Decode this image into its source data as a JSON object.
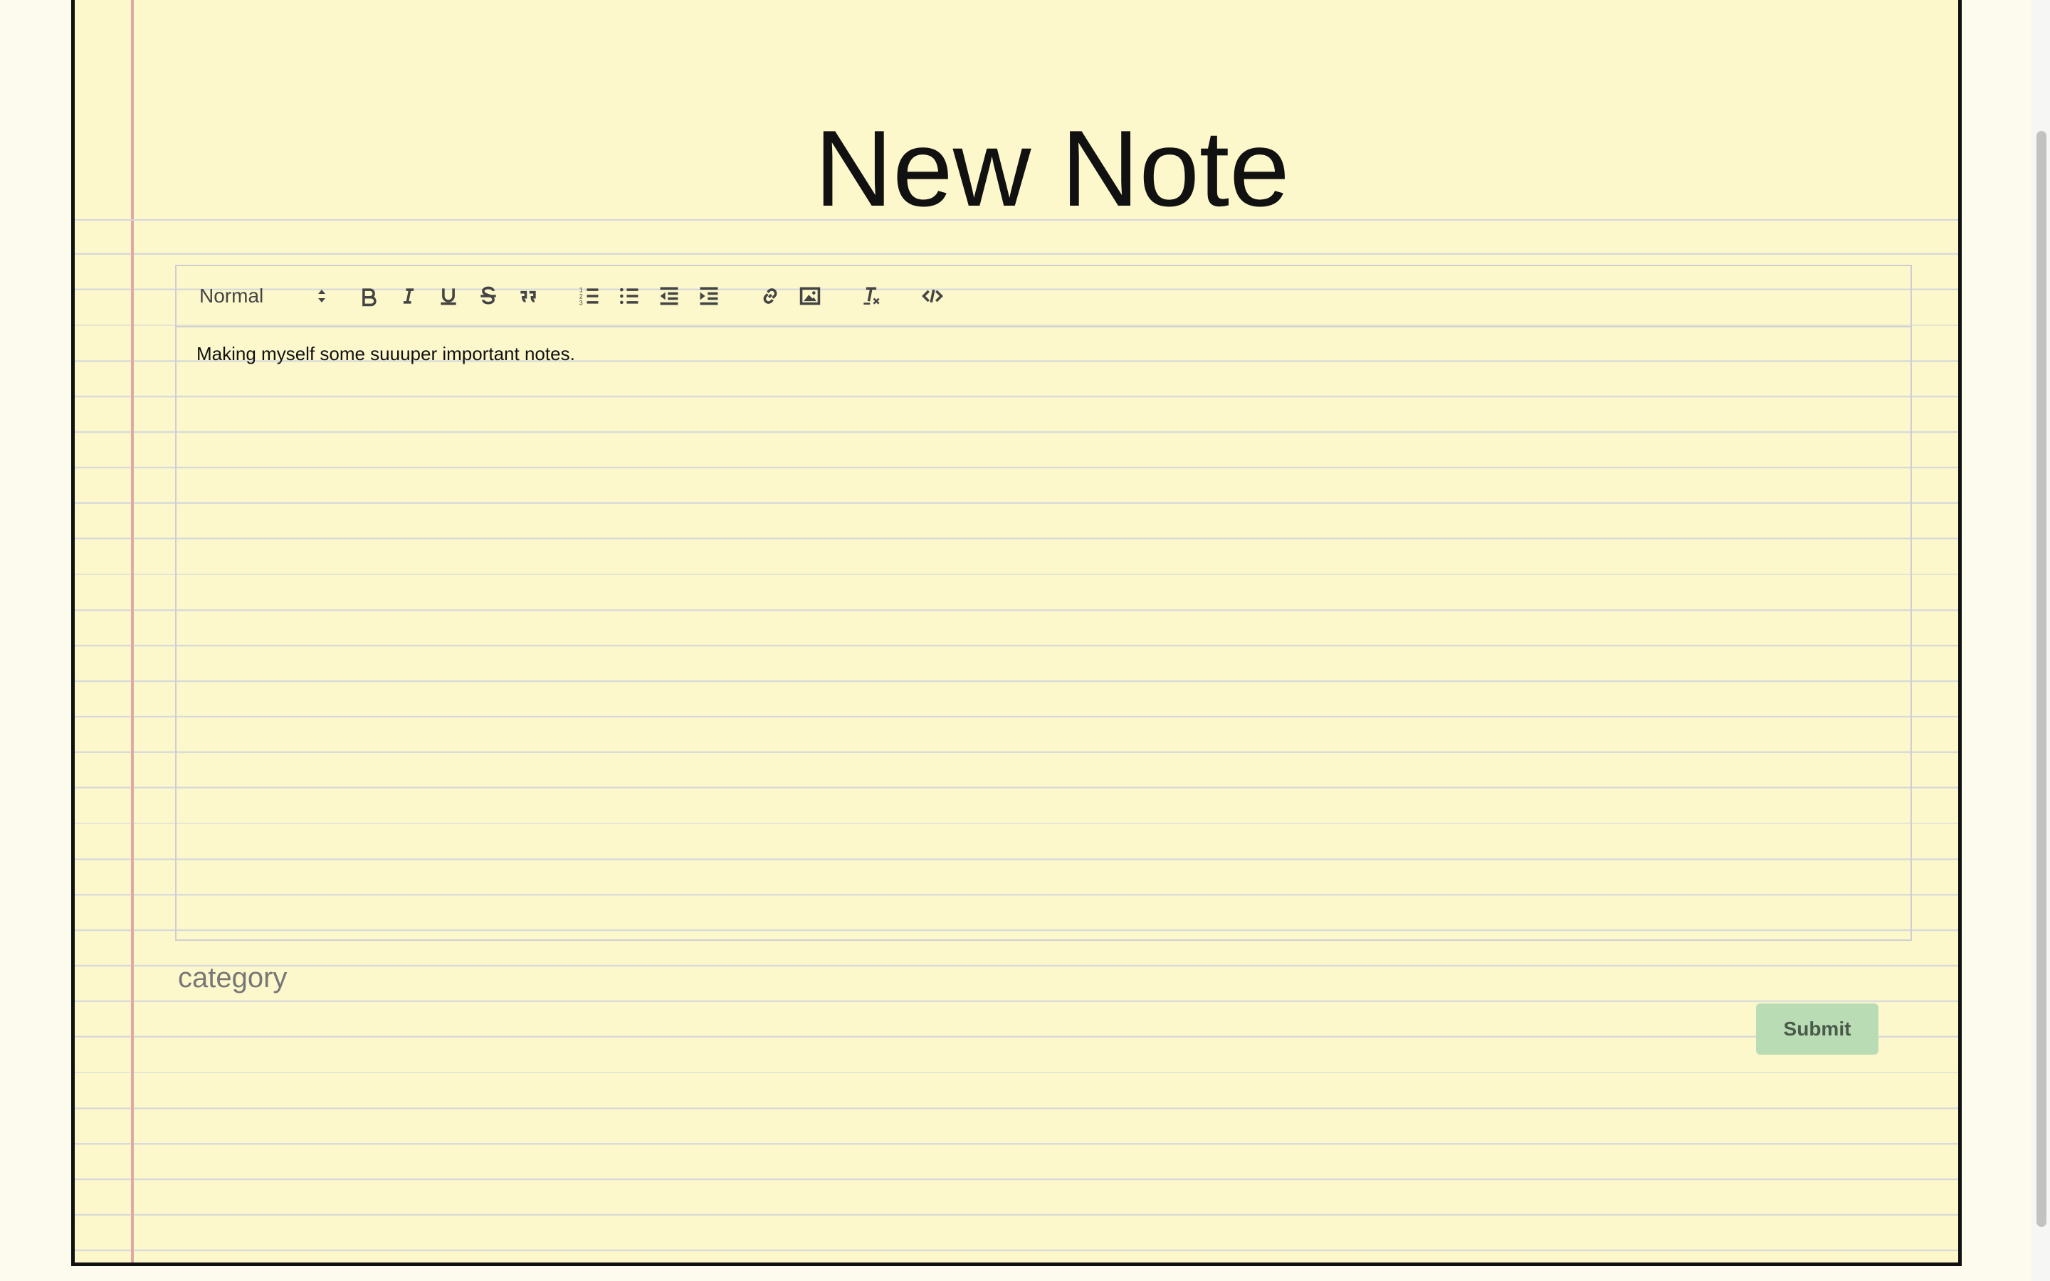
{
  "page": {
    "title": "New Note"
  },
  "editor": {
    "header_select": "Normal",
    "toolbar_icons": [
      "bold-icon",
      "italic-icon",
      "underline-icon",
      "strikethrough-icon",
      "blockquote-icon",
      "ordered-list-icon",
      "bullet-list-icon",
      "outdent-icon",
      "indent-icon",
      "link-icon",
      "image-icon",
      "clear-format-icon",
      "code-icon"
    ],
    "content": "Making myself some suuuper important notes."
  },
  "form": {
    "category_placeholder": "category",
    "submit_label": "Submit"
  },
  "colors": {
    "paper": "#fcf8cb",
    "margin_line": "#e0a9a4",
    "submit_bg": "#badcb4"
  }
}
